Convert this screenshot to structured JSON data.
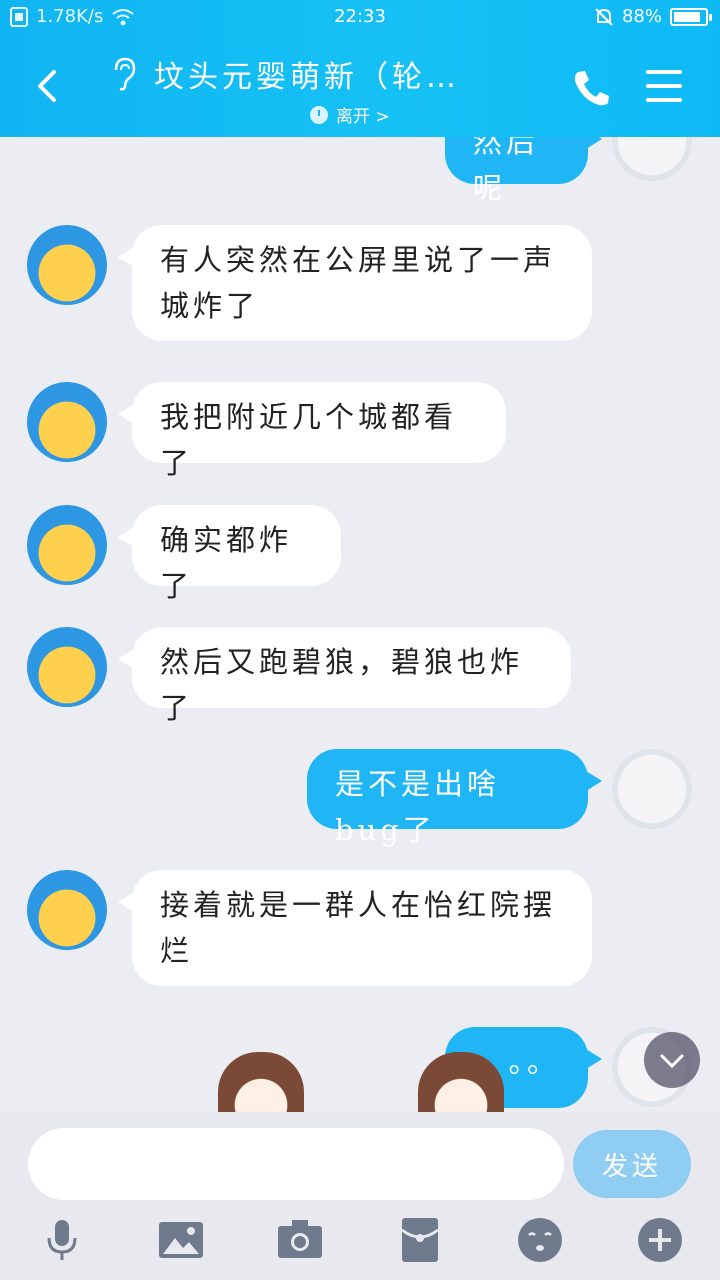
{
  "status_bar": {
    "network_speed": "1.78K/s",
    "time": "22:33",
    "battery": "88%",
    "battery_level": 0.88
  },
  "header": {
    "title": "坟头元婴萌新（轮…",
    "subtitle": "离开 >"
  },
  "messages": [
    {
      "side": "right",
      "text": "然后呢"
    },
    {
      "side": "left",
      "text": "有人突然在公屏里说了一声城炸了"
    },
    {
      "side": "left",
      "text": "我把附近几个城都看了"
    },
    {
      "side": "left",
      "text": "确实都炸了"
    },
    {
      "side": "left",
      "text": "然后又跑碧狼，碧狼也炸了"
    },
    {
      "side": "right",
      "text": "是不是出啥bug了"
    },
    {
      "side": "left",
      "text": "接着就是一群人在怡红院摆烂"
    },
    {
      "side": "right",
      "text": "。。"
    }
  ],
  "input": {
    "placeholder": "",
    "send_label": "发送"
  },
  "toolbar": [
    "microphone-icon",
    "image-icon",
    "camera-icon",
    "red-packet-icon",
    "emoji-icon",
    "plus-icon"
  ],
  "colors": {
    "header": "#12b6f3",
    "bubble_self": "#20b6f5",
    "bubble_other": "#ffffff",
    "background": "#ecedf2"
  }
}
